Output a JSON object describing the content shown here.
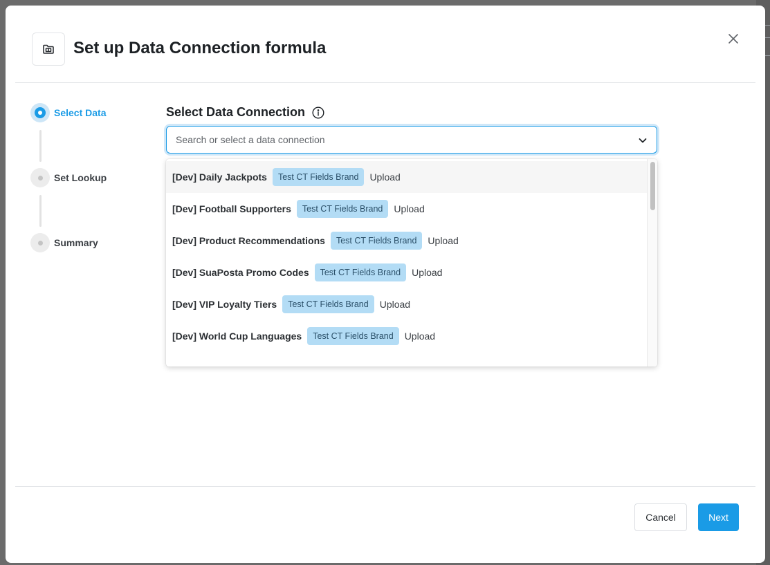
{
  "modal": {
    "title": "Set up Data Connection formula"
  },
  "steps": [
    {
      "label": "Select Data",
      "state": "active"
    },
    {
      "label": "Set Lookup",
      "state": "inactive"
    },
    {
      "label": "Summary",
      "state": "inactive"
    }
  ],
  "select": {
    "title": "Select Data Connection",
    "placeholder": "Search or select a data connection"
  },
  "options": [
    {
      "name": "[Dev] Daily Jackpots",
      "tag": "Test CT Fields Brand",
      "type": "Upload"
    },
    {
      "name": "[Dev] Football Supporters",
      "tag": "Test CT Fields Brand",
      "type": "Upload"
    },
    {
      "name": "[Dev] Product Recommendations",
      "tag": "Test CT Fields Brand",
      "type": "Upload"
    },
    {
      "name": "[Dev] SuaPosta Promo Codes",
      "tag": "Test CT Fields Brand",
      "type": "Upload"
    },
    {
      "name": "[Dev] VIP Loyalty Tiers",
      "tag": "Test CT Fields Brand",
      "type": "Upload"
    },
    {
      "name": "[Dev] World Cup Languages",
      "tag": "Test CT Fields Brand",
      "type": "Upload"
    }
  ],
  "footer": {
    "cancel_label": "Cancel",
    "next_label": "Next"
  },
  "colors": {
    "accent": "#1a9be6",
    "tag_bg": "#b3dcf5"
  }
}
